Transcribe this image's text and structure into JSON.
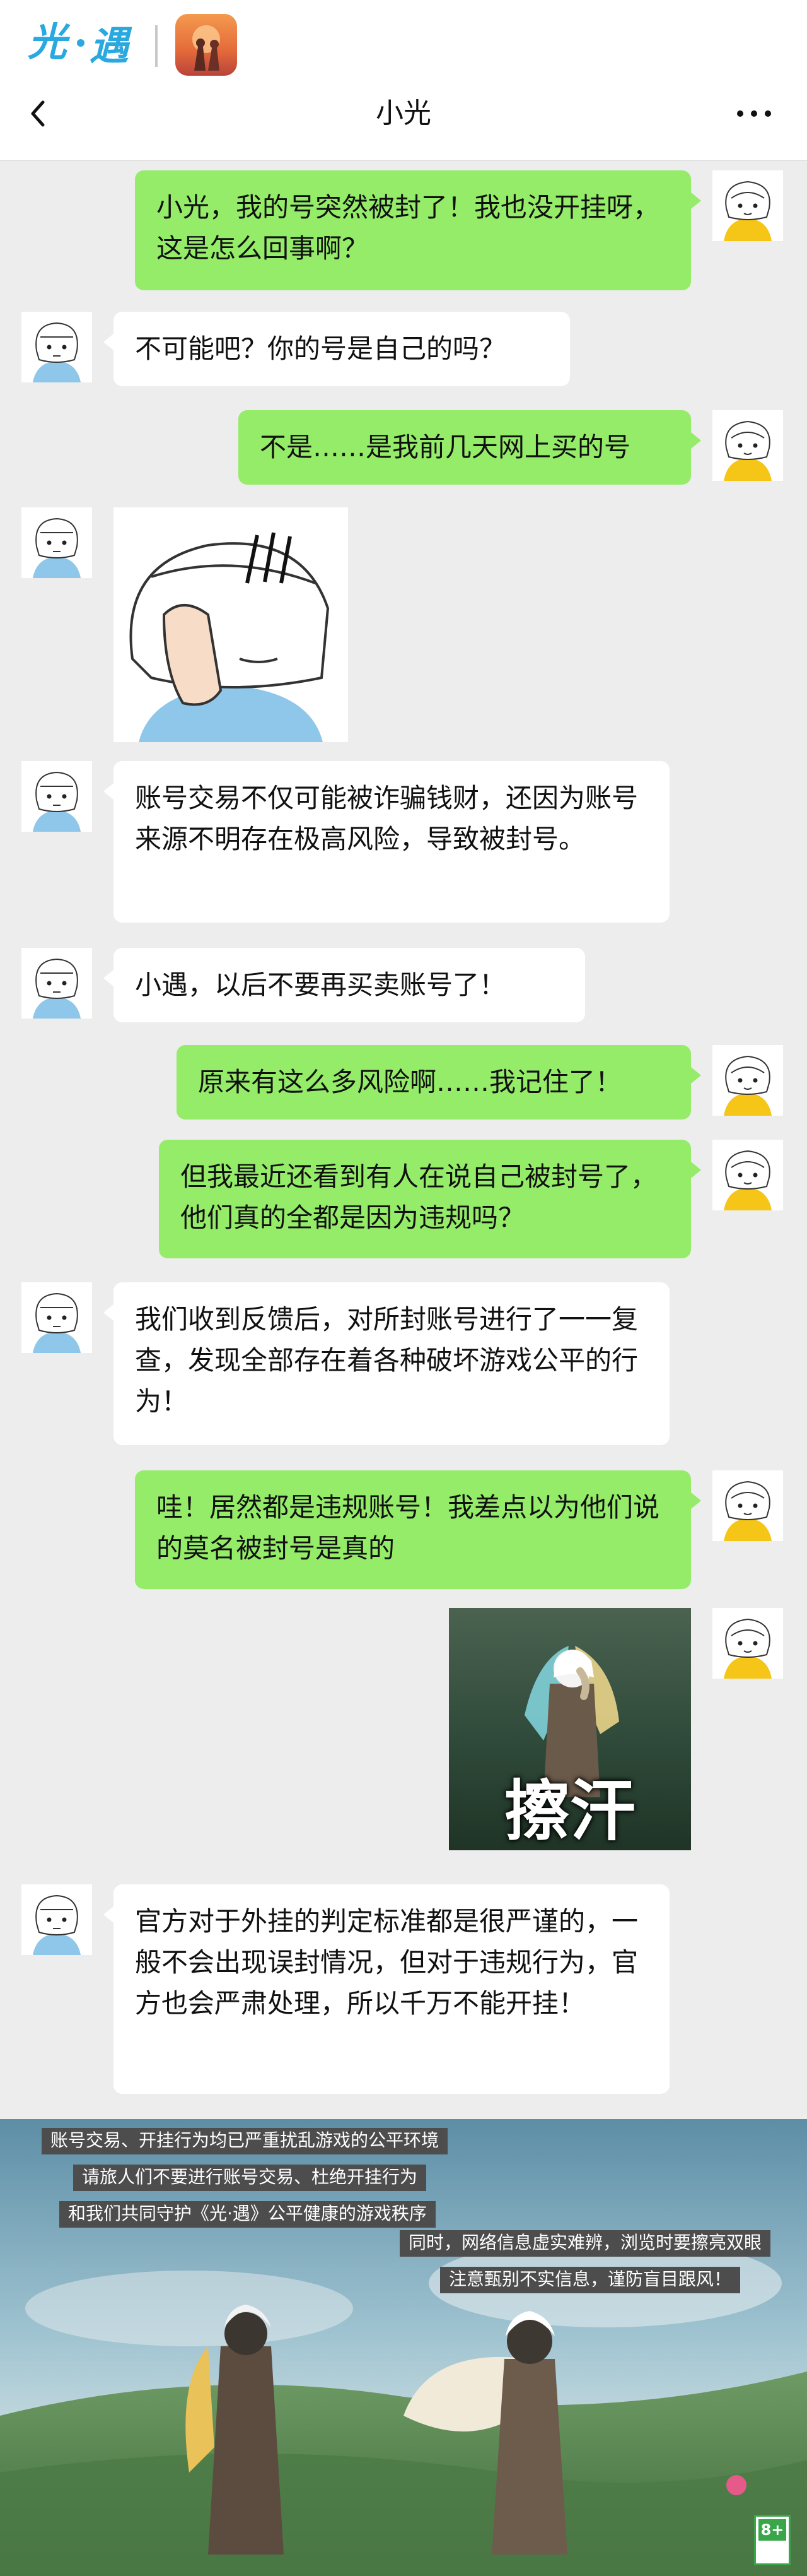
{
  "header": {
    "brand": "光·遇",
    "contact_name": "小光"
  },
  "messages": [
    {
      "from": "me",
      "text": "小光，我的号突然被封了！我也没开挂呀，这是怎么回事啊？"
    },
    {
      "from": "other",
      "text": "不可能吧？你的号是自己的吗？"
    },
    {
      "from": "me",
      "text": "不是……是我前几天网上买的号"
    },
    {
      "from": "other",
      "type": "sticker",
      "icon": "facepalm-sticker"
    },
    {
      "from": "other",
      "text": "账号交易不仅可能被诈骗钱财，还因为账号来源不明存在极高风险，导致被封号。"
    },
    {
      "from": "other",
      "text": "小遇，以后不要再买卖账号了！"
    },
    {
      "from": "me",
      "text": "原来有这么多风险啊……我记住了！"
    },
    {
      "from": "me",
      "text": "但我最近还看到有人在说自己被封号了，他们真的全都是因为违规吗？"
    },
    {
      "from": "other",
      "text": "我们收到反馈后，对所封账号进行了一一复查，发现全部存在着各种破坏游戏公平的行为！"
    },
    {
      "from": "me",
      "text": "哇！居然都是违规账号！我差点以为他们说的莫名被封号是真的"
    },
    {
      "from": "me",
      "type": "sticker",
      "caption": "擦汗"
    },
    {
      "from": "other",
      "text": "官方对于外挂的判定标准都是很严谨的，一般不会出现误封情况，但对于违规行为，官方也会严肃处理，所以千万不能开挂！"
    }
  ],
  "banner": {
    "lines": [
      "账号交易、开挂行为均已严重扰乱游戏的公平环境",
      "请旅人们不要进行账号交易、杜绝开挂行为",
      "和我们共同守护《光·遇》公平健康的游戏秩序",
      "同时，网络信息虚实难辨，浏览时要擦亮双眼",
      "注意甄别不实信息，谨防盲目跟风！"
    ],
    "age_rating": "8+"
  },
  "colors": {
    "my_bubble": "#95ec69",
    "their_bubble": "#ffffff",
    "chat_background": "#ededed",
    "brand_blue": "#2aa8e0"
  }
}
